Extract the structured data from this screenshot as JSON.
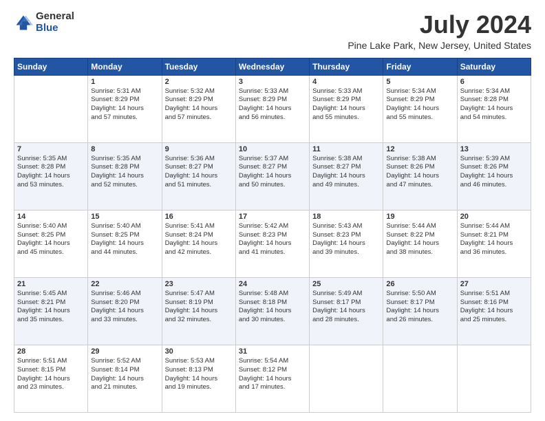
{
  "logo": {
    "general": "General",
    "blue": "Blue"
  },
  "title": "July 2024",
  "subtitle": "Pine Lake Park, New Jersey, United States",
  "days_header": [
    "Sunday",
    "Monday",
    "Tuesday",
    "Wednesday",
    "Thursday",
    "Friday",
    "Saturday"
  ],
  "weeks": [
    [
      {
        "num": "",
        "info": ""
      },
      {
        "num": "1",
        "info": "Sunrise: 5:31 AM\nSunset: 8:29 PM\nDaylight: 14 hours\nand 57 minutes."
      },
      {
        "num": "2",
        "info": "Sunrise: 5:32 AM\nSunset: 8:29 PM\nDaylight: 14 hours\nand 57 minutes."
      },
      {
        "num": "3",
        "info": "Sunrise: 5:33 AM\nSunset: 8:29 PM\nDaylight: 14 hours\nand 56 minutes."
      },
      {
        "num": "4",
        "info": "Sunrise: 5:33 AM\nSunset: 8:29 PM\nDaylight: 14 hours\nand 55 minutes."
      },
      {
        "num": "5",
        "info": "Sunrise: 5:34 AM\nSunset: 8:29 PM\nDaylight: 14 hours\nand 55 minutes."
      },
      {
        "num": "6",
        "info": "Sunrise: 5:34 AM\nSunset: 8:28 PM\nDaylight: 14 hours\nand 54 minutes."
      }
    ],
    [
      {
        "num": "7",
        "info": "Sunrise: 5:35 AM\nSunset: 8:28 PM\nDaylight: 14 hours\nand 53 minutes."
      },
      {
        "num": "8",
        "info": "Sunrise: 5:35 AM\nSunset: 8:28 PM\nDaylight: 14 hours\nand 52 minutes."
      },
      {
        "num": "9",
        "info": "Sunrise: 5:36 AM\nSunset: 8:27 PM\nDaylight: 14 hours\nand 51 minutes."
      },
      {
        "num": "10",
        "info": "Sunrise: 5:37 AM\nSunset: 8:27 PM\nDaylight: 14 hours\nand 50 minutes."
      },
      {
        "num": "11",
        "info": "Sunrise: 5:38 AM\nSunset: 8:27 PM\nDaylight: 14 hours\nand 49 minutes."
      },
      {
        "num": "12",
        "info": "Sunrise: 5:38 AM\nSunset: 8:26 PM\nDaylight: 14 hours\nand 47 minutes."
      },
      {
        "num": "13",
        "info": "Sunrise: 5:39 AM\nSunset: 8:26 PM\nDaylight: 14 hours\nand 46 minutes."
      }
    ],
    [
      {
        "num": "14",
        "info": "Sunrise: 5:40 AM\nSunset: 8:25 PM\nDaylight: 14 hours\nand 45 minutes."
      },
      {
        "num": "15",
        "info": "Sunrise: 5:40 AM\nSunset: 8:25 PM\nDaylight: 14 hours\nand 44 minutes."
      },
      {
        "num": "16",
        "info": "Sunrise: 5:41 AM\nSunset: 8:24 PM\nDaylight: 14 hours\nand 42 minutes."
      },
      {
        "num": "17",
        "info": "Sunrise: 5:42 AM\nSunset: 8:23 PM\nDaylight: 14 hours\nand 41 minutes."
      },
      {
        "num": "18",
        "info": "Sunrise: 5:43 AM\nSunset: 8:23 PM\nDaylight: 14 hours\nand 39 minutes."
      },
      {
        "num": "19",
        "info": "Sunrise: 5:44 AM\nSunset: 8:22 PM\nDaylight: 14 hours\nand 38 minutes."
      },
      {
        "num": "20",
        "info": "Sunrise: 5:44 AM\nSunset: 8:21 PM\nDaylight: 14 hours\nand 36 minutes."
      }
    ],
    [
      {
        "num": "21",
        "info": "Sunrise: 5:45 AM\nSunset: 8:21 PM\nDaylight: 14 hours\nand 35 minutes."
      },
      {
        "num": "22",
        "info": "Sunrise: 5:46 AM\nSunset: 8:20 PM\nDaylight: 14 hours\nand 33 minutes."
      },
      {
        "num": "23",
        "info": "Sunrise: 5:47 AM\nSunset: 8:19 PM\nDaylight: 14 hours\nand 32 minutes."
      },
      {
        "num": "24",
        "info": "Sunrise: 5:48 AM\nSunset: 8:18 PM\nDaylight: 14 hours\nand 30 minutes."
      },
      {
        "num": "25",
        "info": "Sunrise: 5:49 AM\nSunset: 8:17 PM\nDaylight: 14 hours\nand 28 minutes."
      },
      {
        "num": "26",
        "info": "Sunrise: 5:50 AM\nSunset: 8:17 PM\nDaylight: 14 hours\nand 26 minutes."
      },
      {
        "num": "27",
        "info": "Sunrise: 5:51 AM\nSunset: 8:16 PM\nDaylight: 14 hours\nand 25 minutes."
      }
    ],
    [
      {
        "num": "28",
        "info": "Sunrise: 5:51 AM\nSunset: 8:15 PM\nDaylight: 14 hours\nand 23 minutes."
      },
      {
        "num": "29",
        "info": "Sunrise: 5:52 AM\nSunset: 8:14 PM\nDaylight: 14 hours\nand 21 minutes."
      },
      {
        "num": "30",
        "info": "Sunrise: 5:53 AM\nSunset: 8:13 PM\nDaylight: 14 hours\nand 19 minutes."
      },
      {
        "num": "31",
        "info": "Sunrise: 5:54 AM\nSunset: 8:12 PM\nDaylight: 14 hours\nand 17 minutes."
      },
      {
        "num": "",
        "info": ""
      },
      {
        "num": "",
        "info": ""
      },
      {
        "num": "",
        "info": ""
      }
    ]
  ]
}
